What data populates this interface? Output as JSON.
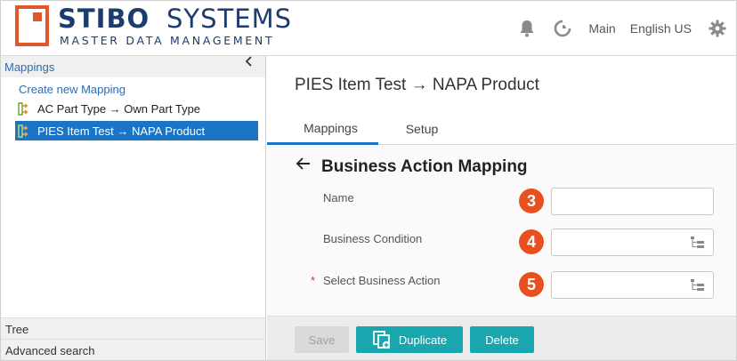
{
  "brand": {
    "name_bold": "STIBO",
    "name_light": "SYSTEMS",
    "tagline": "MASTER DATA MANAGEMENT",
    "accent_color": "#e0582a",
    "text_color": "#1d3c6e"
  },
  "header": {
    "workspace": "Main",
    "language": "English US",
    "icons": [
      "bell-icon",
      "refresh-icon",
      "gear-icon"
    ]
  },
  "left_panel": {
    "title": "Mappings",
    "collapse_glyph": "‹",
    "create_link": "Create new Mapping",
    "items": [
      {
        "label": "AC Part Type → Own Part Type",
        "selected": false
      },
      {
        "label": "PIES Item Test → NAPA Product",
        "selected": true
      }
    ],
    "footer_tabs": [
      "Tree",
      "Advanced search"
    ]
  },
  "main": {
    "title": "PIES Item Test → NAPA Product",
    "tabs": [
      {
        "label": "Mappings",
        "active": true
      },
      {
        "label": "Setup",
        "active": false
      }
    ],
    "section_title": "Business Action Mapping",
    "fields": [
      {
        "label": "Name",
        "badge": "3",
        "required": false,
        "value": "",
        "has_picker": false
      },
      {
        "label": "Business Condition",
        "badge": "4",
        "required": false,
        "value": "",
        "has_picker": true
      },
      {
        "label": "Select Business Action",
        "badge": "5",
        "required": true,
        "value": "",
        "has_picker": true
      }
    ],
    "buttons": {
      "save": "Save",
      "duplicate": "Duplicate",
      "delete": "Delete"
    },
    "colors": {
      "primary": "#1c74c4",
      "action": "#1aa6ae",
      "badge": "#e8501f"
    }
  }
}
